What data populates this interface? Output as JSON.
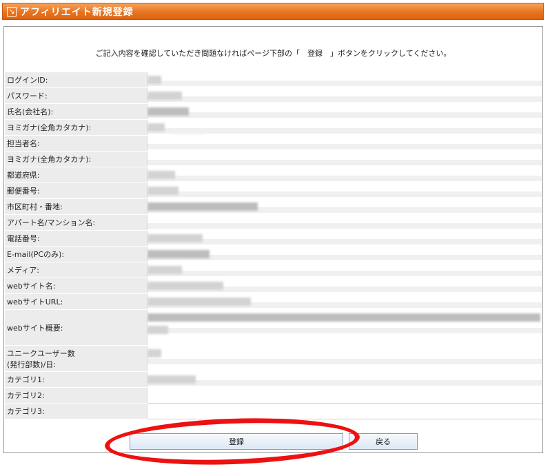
{
  "header": {
    "title": "アフィリエイト新規登録",
    "icon": "arrow-down-right-icon"
  },
  "instruction": "ご記入内容を確認していただき問題なければページ下部の「　登録　」ボタンをクリックしてください。",
  "fields": [
    {
      "label": "ログインID:"
    },
    {
      "label": "パスワード:"
    },
    {
      "label": "氏名(会社名):"
    },
    {
      "label": "ヨミガナ(全角カタカナ):"
    },
    {
      "label": "担当者名:"
    },
    {
      "label": "ヨミガナ(全角カタカナ):"
    },
    {
      "label": "都道府県:"
    },
    {
      "label": "郵便番号:"
    },
    {
      "label": "市区町村・番地:"
    },
    {
      "label": "アパート名/マンション名:"
    },
    {
      "label": "電話番号:"
    },
    {
      "label": "E-mail(PCのみ):"
    },
    {
      "label": "メディア:"
    },
    {
      "label": "webサイト名:"
    },
    {
      "label": "webサイトURL:"
    },
    {
      "label": "webサイト概要:"
    },
    {
      "label": "ユニークユーザー数\n(発行部数)/日:"
    },
    {
      "label": "カテゴリ1:"
    },
    {
      "label": "カテゴリ2:"
    },
    {
      "label": "カテゴリ3:"
    }
  ],
  "buttons": {
    "register": "登録",
    "back": "戻る"
  },
  "colors": {
    "header": "#e8731f",
    "highlight": "#ee1111",
    "label_bg": "#ececec"
  }
}
